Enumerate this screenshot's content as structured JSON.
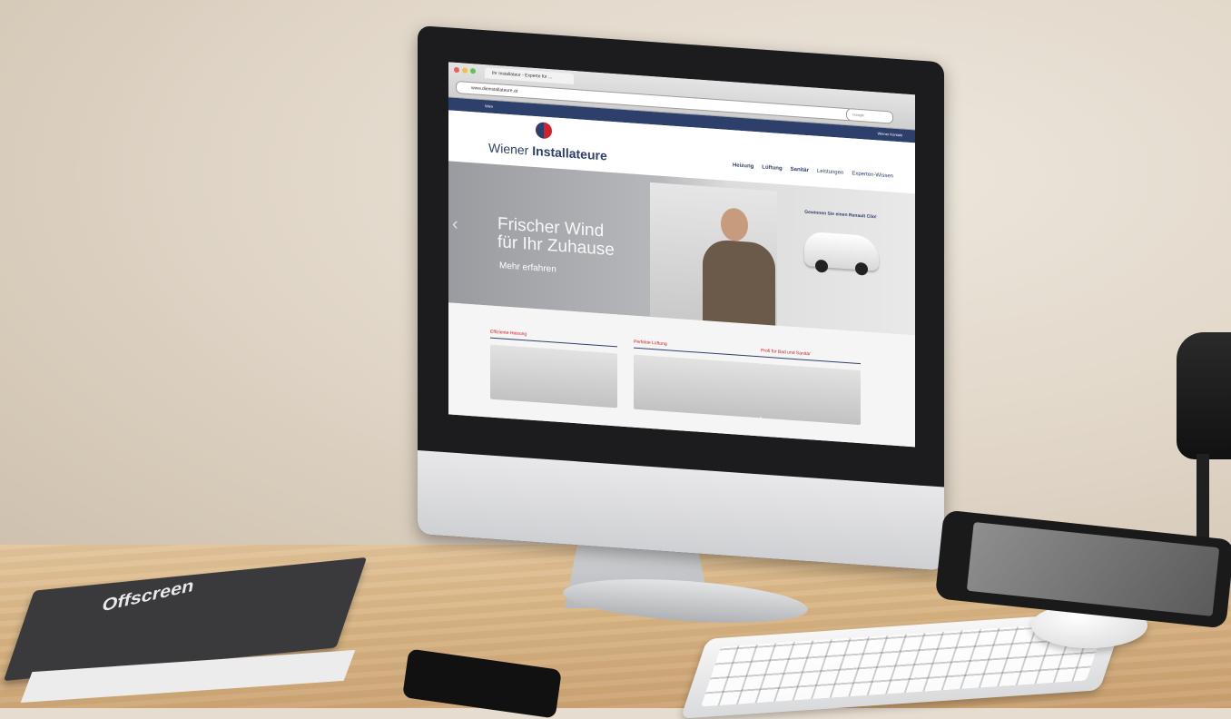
{
  "browser": {
    "tab_title": "Ihr Installateur - Experte für ...",
    "url": "www.dieinstallateure.at",
    "search_placeholder": "Google"
  },
  "site": {
    "topbar_left": "Wien",
    "topbar_right": "Wiener Kontakt",
    "logo_text_regular": "Wiener",
    "logo_text_bold": "Installateure",
    "nav": [
      "Heizung",
      "Lüftung",
      "Sanitär",
      "Leistungen",
      "Experten-Wissen"
    ],
    "hero": {
      "title_line1": "Frischer Wind",
      "title_line2": "für Ihr Zuhause",
      "cta": "Mehr erfahren",
      "promo": "Gewinnen Sie einen Renault Clio!"
    },
    "features": [
      {
        "title": "Effiziente Heizung"
      },
      {
        "title": "Perfekte Lüftung"
      },
      {
        "title": "Profi für Bad und Sanitär"
      }
    ]
  },
  "desk_items": {
    "magazine_title": "Offscreen"
  },
  "colors": {
    "brand_navy": "#2d3f6b",
    "brand_red": "#d4202b"
  }
}
